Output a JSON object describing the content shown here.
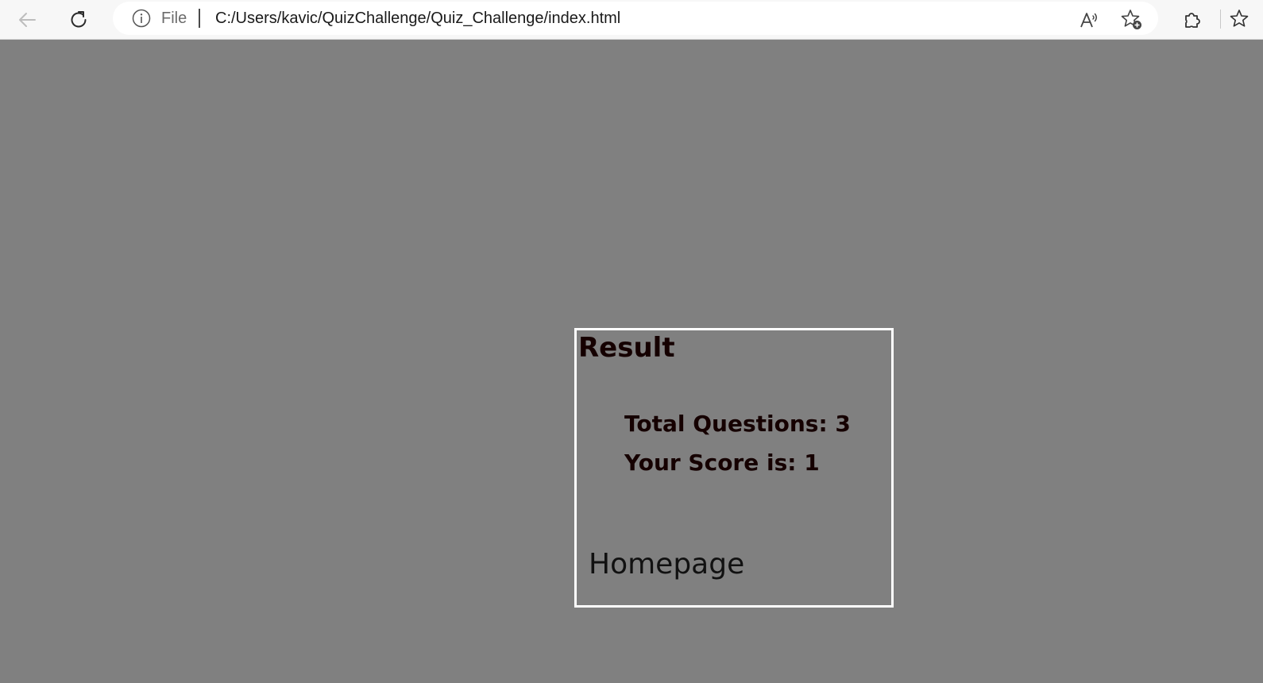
{
  "browser": {
    "scheme_label": "File",
    "url": "C:/Users/kavic/QuizChallenge/Quiz_Challenge/index.html",
    "icons": {
      "back": "arrow-left-icon",
      "reload": "reload-icon",
      "site_info": "info-icon",
      "read_aloud": "read-aloud-icon",
      "add_favorite": "star-plus-icon",
      "extensions": "puzzle-icon",
      "favorites": "star-list-icon"
    }
  },
  "result": {
    "title": "Result",
    "total_questions": "Total Questions: 3",
    "score": "Your Score is: 1",
    "homepage_link": "Homepage"
  },
  "colors": {
    "page_background": "#808080",
    "card_border": "#ffffff",
    "text": "#150000"
  }
}
